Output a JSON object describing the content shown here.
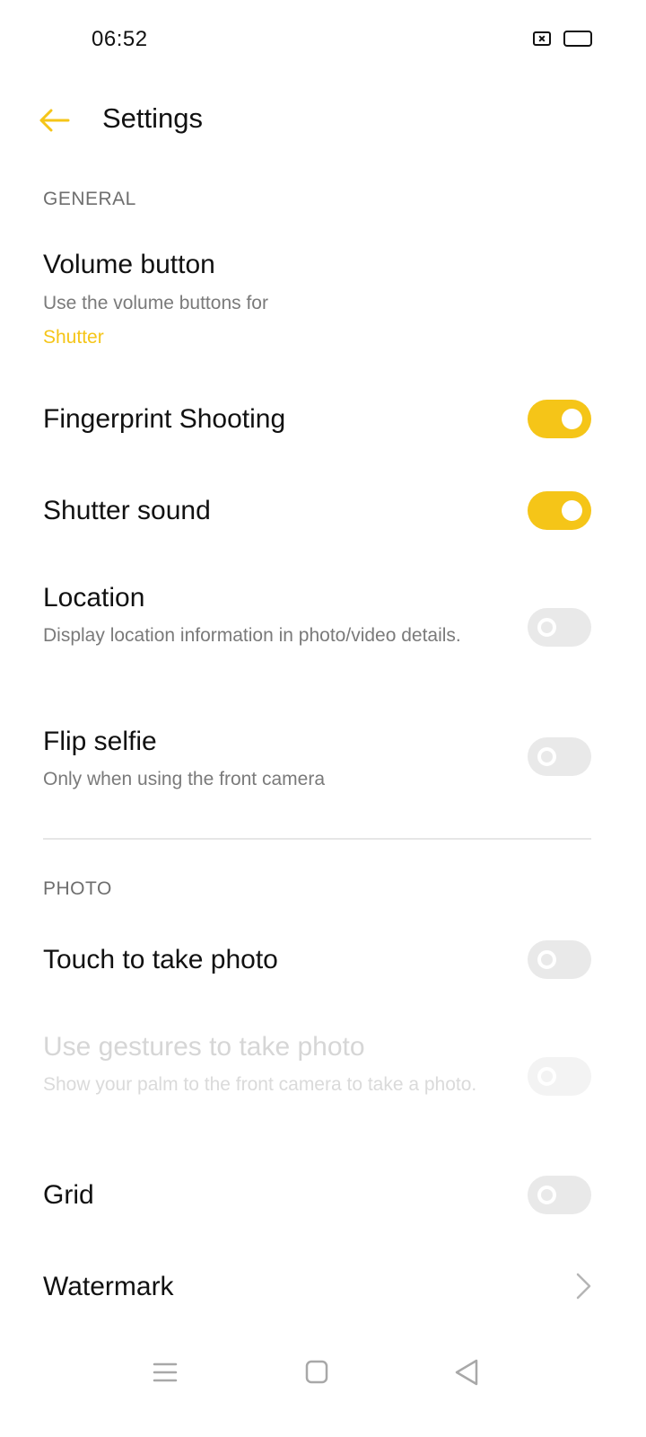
{
  "status_bar": {
    "time": "06:52",
    "icons": [
      "no-sim-icon",
      "battery-full-icon"
    ]
  },
  "header": {
    "back_icon": "arrow-left-icon",
    "title": "Settings"
  },
  "colors": {
    "accent": "#f5c518",
    "title_text": "#111111",
    "secondary_text": "#7a7a7a",
    "section_header": "#6e6e6e",
    "disabled_text": "#d6d6d6",
    "toggle_off": "#e9e9e9"
  },
  "sections": {
    "general": {
      "header": "GENERAL",
      "volume_button": {
        "title": "Volume button",
        "subtitle": "Use the volume buttons for",
        "value": "Shutter"
      },
      "fingerprint_shooting": {
        "title": "Fingerprint Shooting",
        "enabled": true
      },
      "shutter_sound": {
        "title": "Shutter sound",
        "enabled": true
      },
      "location": {
        "title": "Location",
        "subtitle": "Display location information in photo/video details.",
        "enabled": false
      },
      "flip_selfie": {
        "title": "Flip selfie",
        "subtitle": "Only when using the front camera",
        "enabled": false
      }
    },
    "photo": {
      "header": "PHOTO",
      "touch_to_take_photo": {
        "title": "Touch to take photo",
        "enabled": false
      },
      "gestures": {
        "title": "Use gestures to take photo",
        "subtitle": "Show your palm to the front camera to take a photo.",
        "enabled": false,
        "disabled": true
      },
      "grid": {
        "title": "Grid",
        "enabled": false
      },
      "watermark": {
        "title": "Watermark",
        "icon": "chevron-right-icon"
      }
    }
  },
  "nav_bar": {
    "icons": [
      "menu-icon",
      "home-icon",
      "back-triangle-icon"
    ]
  }
}
